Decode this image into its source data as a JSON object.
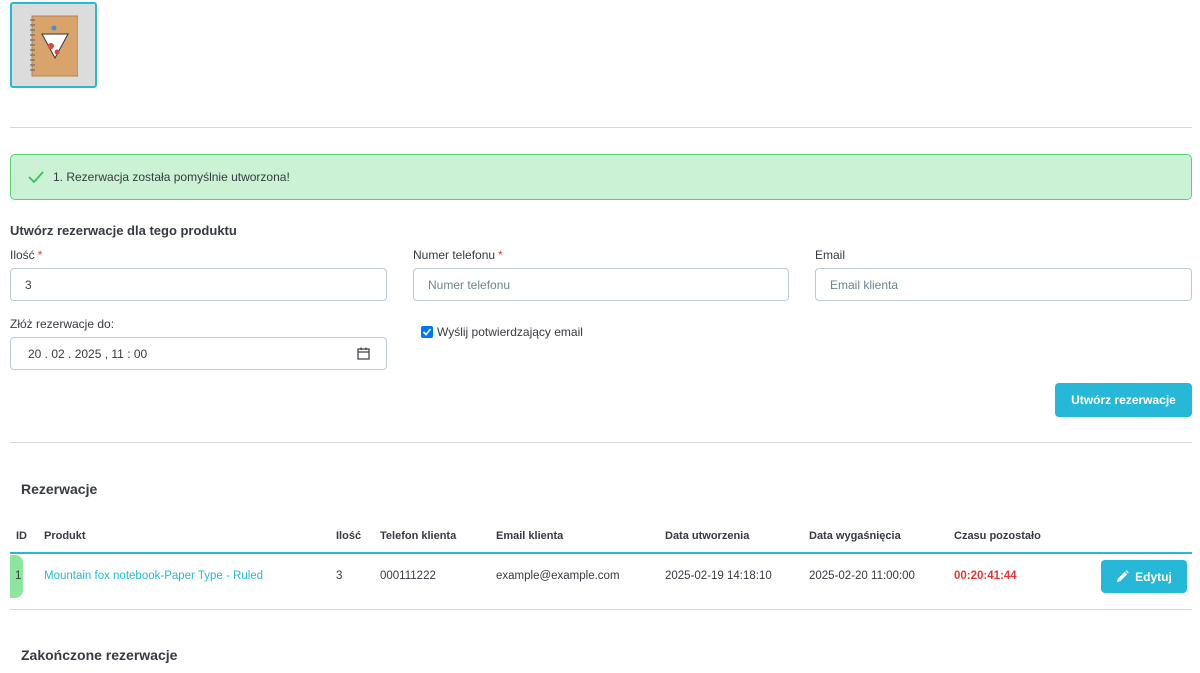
{
  "alert": {
    "message": "1. Rezerwacja została pomyślnie utworzona!"
  },
  "form": {
    "title": "Utwórz rezerwacje dla tego produktu",
    "quantity": {
      "label": "Ilość",
      "required_mark": "*",
      "value": "3"
    },
    "phone": {
      "label": "Numer telefonu",
      "required_mark": "*",
      "placeholder": "Numer telefonu"
    },
    "email": {
      "label": "Email",
      "placeholder": "Email klienta"
    },
    "until": {
      "label": "Złóż rezerwacje do:",
      "value": "20 . 02 . 2025 ,  11 : 00"
    },
    "send_email": {
      "label": "Wyślij potwierdzający email",
      "checked": true
    },
    "submit_label": "Utwórz rezerwacje"
  },
  "reservations": {
    "title": "Rezerwacje",
    "columns": [
      "ID",
      "Produkt",
      "Ilość",
      "Telefon klienta",
      "Email klienta",
      "Data utworzenia",
      "Data wygaśnięcia",
      "Czasu pozostało"
    ],
    "rows": [
      {
        "id": "1",
        "product": "Mountain fox notebook-Paper Type - Ruled",
        "quantity": "3",
        "phone": "000111222",
        "email": "example@example.com",
        "created": "2025-02-19 14:18:10",
        "expires": "2025-02-20 11:00:00",
        "remaining": "00:20:41:44",
        "edit_label": "Edytuj"
      }
    ]
  },
  "finished": {
    "title": "Zakończone rezerwacje"
  },
  "colors": {
    "accent": "#25b9d7",
    "success_bg": "#cbf2d4",
    "success_border": "#53d572",
    "danger": "#e23a3a"
  }
}
